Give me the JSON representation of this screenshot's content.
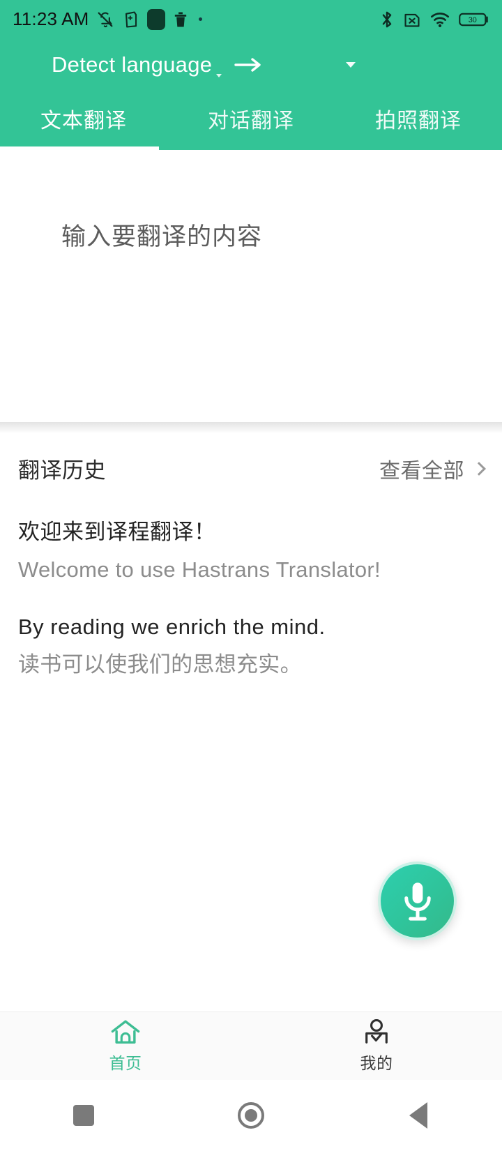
{
  "status_bar": {
    "time": "11:23 AM",
    "left_icons": [
      "bell-off-icon",
      "clipboard-icon",
      "dark-square-icon",
      "trash-icon",
      "dot-icon"
    ],
    "right_icons": [
      "bluetooth-icon",
      "no-sim-icon",
      "wifi-icon",
      "battery-icon"
    ],
    "battery_level": "30"
  },
  "header": {
    "source_language": "Detect language",
    "swap_arrow_icon": "arrow-right-icon",
    "target_language_caret_icon": "caret-down-icon",
    "accent_color": "#33c496",
    "tabs": [
      {
        "label": "文本翻译",
        "active": true
      },
      {
        "label": "对话翻译",
        "active": false
      },
      {
        "label": "拍照翻译",
        "active": false
      }
    ]
  },
  "input_area": {
    "placeholder": "输入要翻译的内容",
    "value": ""
  },
  "history": {
    "title": "翻译历史",
    "view_all_label": "查看全部",
    "view_all_chevron_icon": "chevron-right-icon",
    "items": [
      {
        "source": "欢迎来到译程翻译！",
        "target": "Welcome to use Hastrans Translator!"
      },
      {
        "source": "By reading we enrich the mind.",
        "target": "读书可以使我们的思想充实。"
      }
    ]
  },
  "voice_button": {
    "icon": "microphone-icon",
    "gradient_start": "#2ecfae",
    "gradient_end": "#34b98a"
  },
  "bottom_nav": {
    "items": [
      {
        "label": "首页",
        "icon": "home-icon",
        "active": true,
        "color": "#3dbd93"
      },
      {
        "label": "我的",
        "icon": "user-check-icon",
        "active": false,
        "color": "#3a3a3a"
      }
    ]
  },
  "android_nav": {
    "buttons": [
      "recents-square-icon",
      "home-circle-icon",
      "back-triangle-icon"
    ]
  }
}
